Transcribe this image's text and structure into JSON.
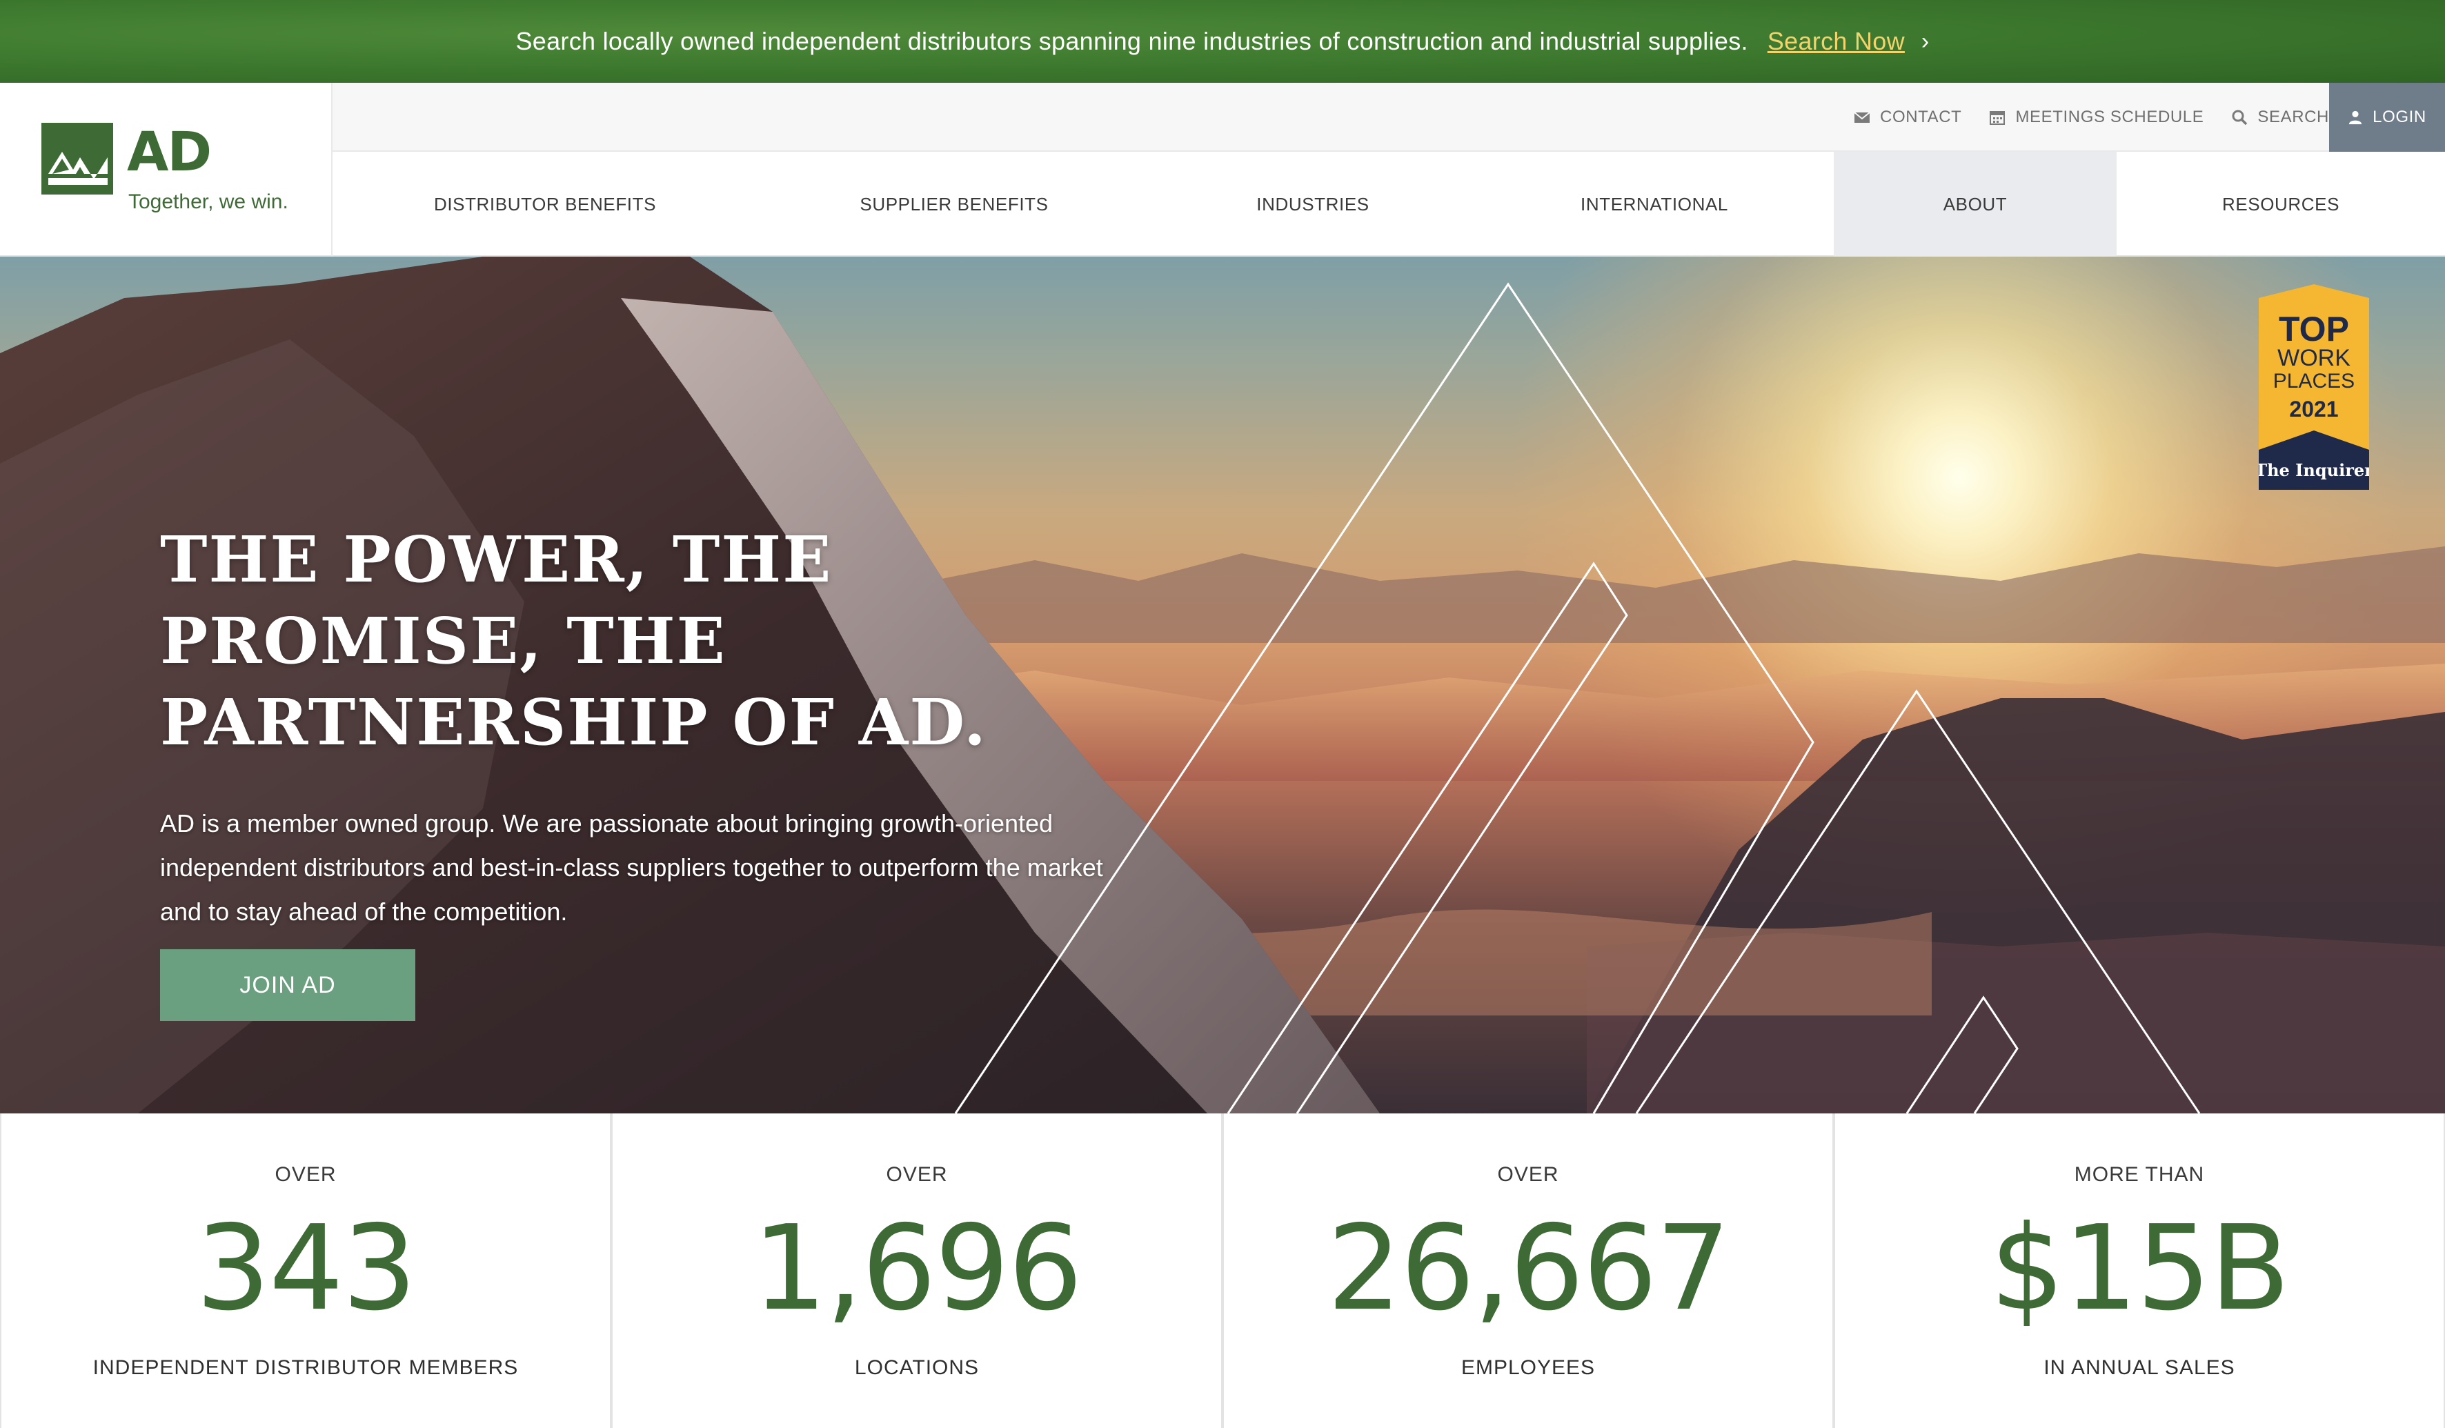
{
  "banner": {
    "message": "Search locally owned independent distributors spanning nine industries of construction and industrial supplies.",
    "cta_label": "Search Now",
    "chevron_glyph": "›"
  },
  "header": {
    "logo_text": "AD",
    "tagline": "Together, we win.",
    "utility": {
      "contact": "CONTACT",
      "meetings": "MEETINGS SCHEDULE",
      "search": "SEARCH",
      "login": "LOGIN"
    },
    "nav": [
      {
        "label": "DISTRIBUTOR BENEFITS"
      },
      {
        "label": "SUPPLIER BENEFITS"
      },
      {
        "label": "INDUSTRIES"
      },
      {
        "label": "INTERNATIONAL"
      },
      {
        "label": "ABOUT",
        "active": true
      },
      {
        "label": "RESOURCES"
      }
    ]
  },
  "hero": {
    "title_lines": [
      "THE POWER, THE",
      "PROMISE, THE",
      "PARTNERSHIP OF AD."
    ],
    "description": "AD is a member owned group. We are passionate about bringing growth-oriented independent distributors and best-in-class suppliers together to outperform the market and to stay ahead of the competition.",
    "button_label": "JOIN AD"
  },
  "badge": {
    "line1": "TOP",
    "line2": "WORK",
    "line3": "PLACES",
    "year": "2021",
    "publisher": "The Inquirer"
  },
  "stats": [
    {
      "pre": "OVER",
      "number": "343",
      "post": "INDEPENDENT DISTRIBUTOR MEMBERS"
    },
    {
      "pre": "OVER",
      "number": "1,696",
      "post": "LOCATIONS"
    },
    {
      "pre": "OVER",
      "number": "26,667",
      "post": "EMPLOYEES"
    },
    {
      "pre": "MORE THAN",
      "number": "$15B",
      "post": "IN ANNUAL SALES"
    }
  ],
  "colors": {
    "brand_green": "#3e6b35",
    "banner_green": "#3e7a2f",
    "cta_yellow": "#f3d36b",
    "button_green": "#6aa07f",
    "login_gray": "#6f7d8b",
    "badge_gold": "#f5b731",
    "badge_navy": "#1f2a4a"
  },
  "icons": {
    "contact": "envelope-icon",
    "meetings": "calendar-icon",
    "search": "magnifier-icon",
    "login": "user-icon"
  }
}
